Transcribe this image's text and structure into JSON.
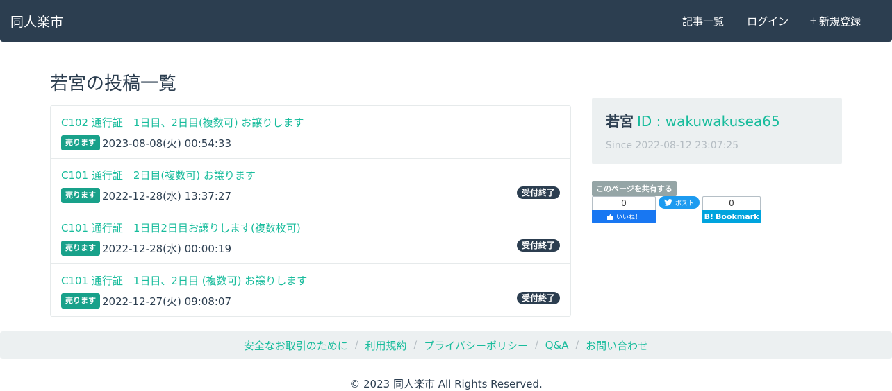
{
  "navbar": {
    "brand": "同人楽市",
    "links": [
      {
        "icon": "",
        "label": "記事一覧"
      },
      {
        "icon": "",
        "label": "ログイン"
      },
      {
        "icon": "+",
        "label": "新規登録"
      }
    ]
  },
  "page_title": "若宮の投稿一覧",
  "posts": [
    {
      "title": "C102 通行証　1日目、2日目(複数可) お譲りします",
      "badge": "売ります",
      "date": "2023-08-08(火) 00:54:33",
      "status": ""
    },
    {
      "title": "C101 通行証　2日目(複数可) お譲ります",
      "badge": "売ります",
      "date": "2022-12-28(水) 13:37:27",
      "status": "受付終了"
    },
    {
      "title": "C101 通行証　1日目2日目お譲りします(複数枚可)",
      "badge": "売ります",
      "date": "2022-12-28(水) 00:00:19",
      "status": "受付終了"
    },
    {
      "title": "C101 通行証　1日目、2日目 (複数可) お譲りします",
      "badge": "売ります",
      "date": "2022-12-27(火) 09:08:07",
      "status": "受付終了"
    }
  ],
  "profile": {
    "icon": "",
    "name": "若宮",
    "id_text": "ID : wakuwakusea65",
    "since_icon": "",
    "since": "Since 2022-08-12 23:07:25"
  },
  "share": {
    "label": "このページを共有する",
    "fb_count": "0",
    "fb_button": "いいね！",
    "tw_button": "ポスト",
    "hb_count": "0",
    "hb_button": "Bookmark"
  },
  "footer": {
    "links": [
      "安全なお取引のために",
      "利用規約",
      "プライバシーポリシー",
      "Q&A",
      "お問い合わせ"
    ],
    "separator": "/",
    "copyright": "© 2023 同人楽市 All Rights Reserved."
  },
  "colors": {
    "navbar": "#2c3e50",
    "accent": "#18bc9c",
    "sell_badge": "#18a18a",
    "closed_badge": "#2c3e50",
    "panel": "#ecf0f1"
  }
}
